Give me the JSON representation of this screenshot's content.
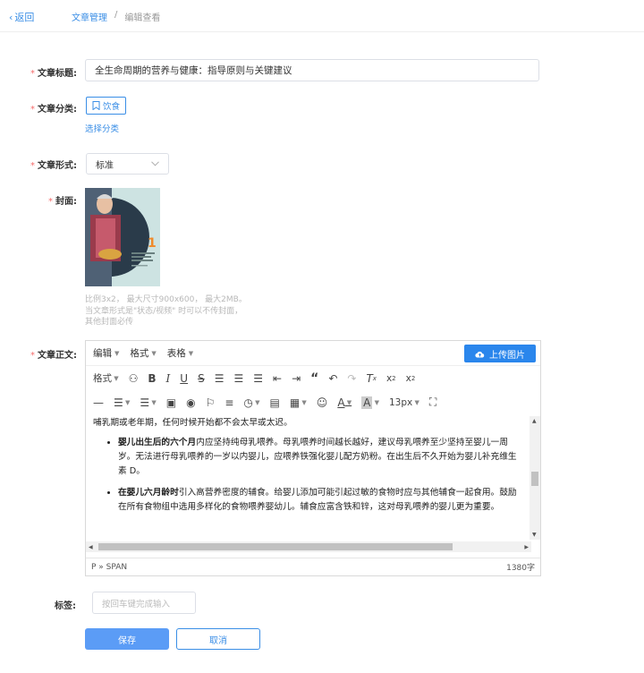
{
  "header": {
    "back_label": "返回",
    "breadcrumb": [
      "文章管理",
      "/",
      "编辑查看"
    ]
  },
  "form": {
    "title_label": "文章标题:",
    "title_value": "全生命周期的营养与健康：指导原则与关键建议",
    "category_label": "文章分类:",
    "category_tag": "饮食",
    "select_category": "选择分类",
    "form_label": "文章形式:",
    "form_value": "标准",
    "cover_label": "封面:",
    "cover_hint": [
      "比例3x2， 最大尺寸900x600， 最大2MB。",
      "当文章形式是\"状态/视频\" 时可以不传封面，",
      "其他封面必传"
    ],
    "body_label": "文章正文:",
    "tags_label": "标签:",
    "tags_placeholder": "按回车键完成输入",
    "save_label": "保存",
    "cancel_label": "取消"
  },
  "editor": {
    "menus": [
      "编辑",
      "格式",
      "表格"
    ],
    "upload_label": "上传图片",
    "format_label": "格式",
    "font_size": "13px",
    "content_intro": "哺乳期或老年期，任何时候开始都不会太早或太迟。",
    "bullets": [
      {
        "bold": "婴儿出生后的六个月",
        "text": "内应坚持纯母乳喂养。母乳喂养时间越长越好，建议母乳喂养至少坚持至婴儿一周岁。无法进行母乳喂养的一岁以内婴儿，应喂养铁强化婴儿配方奶粉。在出生后不久开始为婴儿补充维生素 D。"
      },
      {
        "bold": "在婴儿六月龄时",
        "text": "引入高营养密度的辅食。给婴儿添加可能引起过敏的食物时应与其他辅食一起食用。鼓励在所有食物组中选用多样化的食物喂养婴幼儿。辅食应富含铁和锌，这对母乳喂养的婴儿更为重要。"
      }
    ],
    "status_path": "P » SPAN",
    "word_count": "1380字"
  },
  "colors": {
    "accent": "#3a8ee6",
    "upload_button": "#2a86ec",
    "save_button": "#5b9cf6",
    "required": "#f56c6c"
  }
}
